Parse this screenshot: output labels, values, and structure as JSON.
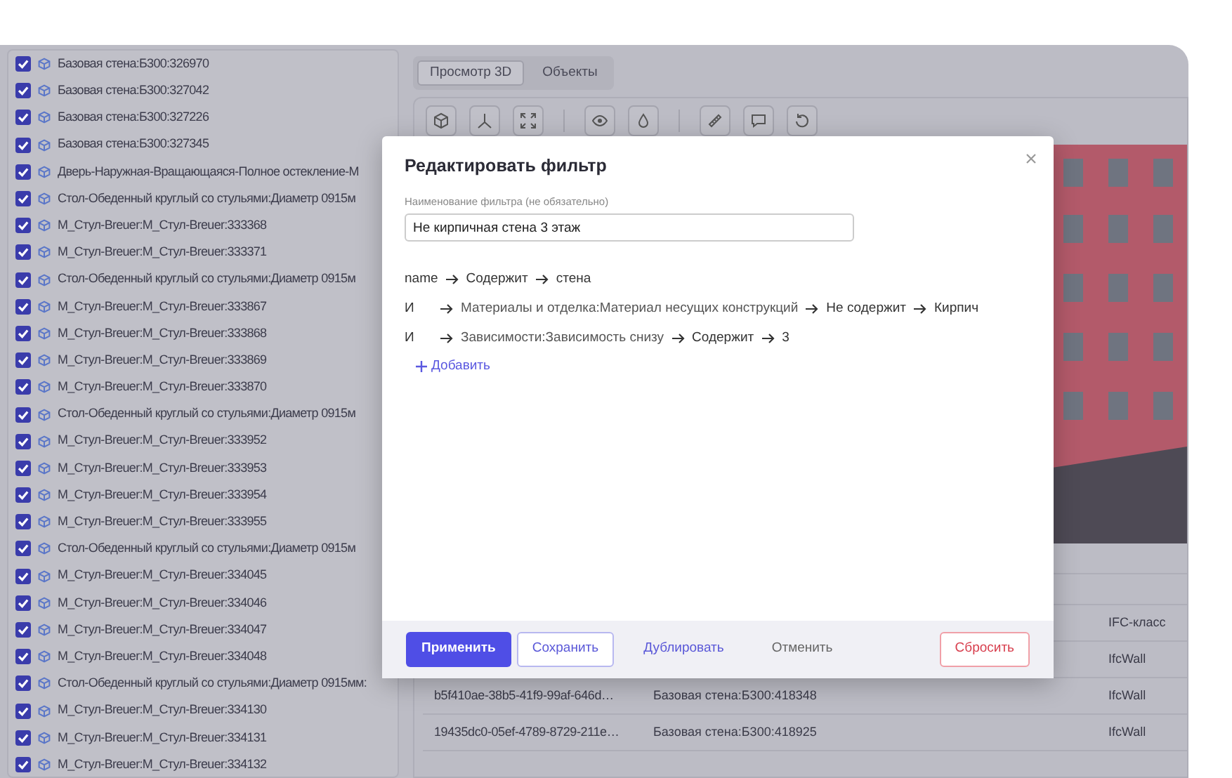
{
  "object_list": {
    "items": [
      {
        "label": "Базовая стена:Б300:326970",
        "checked": true
      },
      {
        "label": "Базовая стена:Б300:327042",
        "checked": true
      },
      {
        "label": "Базовая стена:Б300:327226",
        "checked": true
      },
      {
        "label": "Базовая стена:Б300:327345",
        "checked": true
      },
      {
        "label": "Дверь-Наружная-Вращающаяся-Полное остекление-М",
        "checked": true
      },
      {
        "label": "Стол-Обеденный круглый со стульями:Диаметр 0915м",
        "checked": true
      },
      {
        "label": "М_Стул-Breuer:М_Стул-Breuer:333368",
        "checked": true
      },
      {
        "label": "М_Стул-Breuer:М_Стул-Breuer:333371",
        "checked": true
      },
      {
        "label": "Стол-Обеденный круглый со стульями:Диаметр 0915м",
        "checked": true
      },
      {
        "label": "М_Стул-Breuer:М_Стул-Breuer:333867",
        "checked": true
      },
      {
        "label": "М_Стул-Breuer:М_Стул-Breuer:333868",
        "checked": true
      },
      {
        "label": "М_Стул-Breuer:М_Стул-Breuer:333869",
        "checked": true
      },
      {
        "label": "М_Стул-Breuer:М_Стул-Breuer:333870",
        "checked": true
      },
      {
        "label": "Стол-Обеденный круглый со стульями:Диаметр 0915м",
        "checked": true
      },
      {
        "label": "М_Стул-Breuer:М_Стул-Breuer:333952",
        "checked": true
      },
      {
        "label": "М_Стул-Breuer:М_Стул-Breuer:333953",
        "checked": true
      },
      {
        "label": "М_Стул-Breuer:М_Стул-Breuer:333954",
        "checked": true
      },
      {
        "label": "М_Стул-Breuer:М_Стул-Breuer:333955",
        "checked": true
      },
      {
        "label": "Стол-Обеденный круглый со стульями:Диаметр 0915м",
        "checked": true
      },
      {
        "label": "М_Стул-Breuer:М_Стул-Breuer:334045",
        "checked": true
      },
      {
        "label": "М_Стул-Breuer:М_Стул-Breuer:334046",
        "checked": true
      },
      {
        "label": "М_Стул-Breuer:М_Стул-Breuer:334047",
        "checked": true
      },
      {
        "label": "М_Стул-Breuer:М_Стул-Breuer:334048",
        "checked": true
      },
      {
        "label": "Стол-Обеденный круглый со стульями:Диаметр 0915мм:",
        "checked": true
      },
      {
        "label": "М_Стул-Breuer:М_Стул-Breuer:334130",
        "checked": true
      },
      {
        "label": "М_Стул-Breuer:М_Стул-Breuer:334131",
        "checked": true
      },
      {
        "label": "М_Стул-Breuer:М_Стул-Breuer:334132",
        "checked": true
      }
    ]
  },
  "tabs": [
    {
      "label": "Просмотр 3D",
      "selected": true
    },
    {
      "label": "Объекты",
      "selected": false
    }
  ],
  "table": {
    "header": {
      "column_3": "IFC-класс"
    },
    "rows": [
      {
        "column_3": "IfcWall"
      },
      {
        "column_1": "b5f410ae-38b5-41f9-99af-646d…",
        "column_2": "Базовая стена:Б300:418348",
        "column_3": "IfcWall"
      },
      {
        "column_1": "19435dc0-05ef-4789-8729-211e…",
        "column_2": "Базовая стена:Б300:418925",
        "column_3": "IfcWall"
      }
    ]
  },
  "dialog": {
    "title": "Редактировать фильтр",
    "name_field": {
      "label": "Наименование фильтра (не обязательно)",
      "value": "Не кирпичная стена 3 этаж"
    },
    "conditions": [
      {
        "field": "name",
        "operator": "Содержит",
        "value": "стена"
      },
      {
        "connector": "И",
        "field": "Материалы и отделка:Материал несущих конструкций",
        "operator": "Не содержит",
        "value": "Кирпич"
      },
      {
        "connector": "И",
        "field": "Зависимости:Зависимость снизу",
        "operator": "Содержит",
        "value": "3"
      }
    ],
    "add_label": "Добавить",
    "buttons": [
      {
        "label": "Применить",
        "kind": "primary"
      },
      {
        "label": "Сохранить",
        "kind": "outline"
      },
      {
        "label": "Дублировать",
        "kind": "link"
      },
      {
        "label": "Отменить",
        "kind": "plain"
      },
      {
        "label": "Сбросить",
        "kind": "danger"
      }
    ]
  }
}
